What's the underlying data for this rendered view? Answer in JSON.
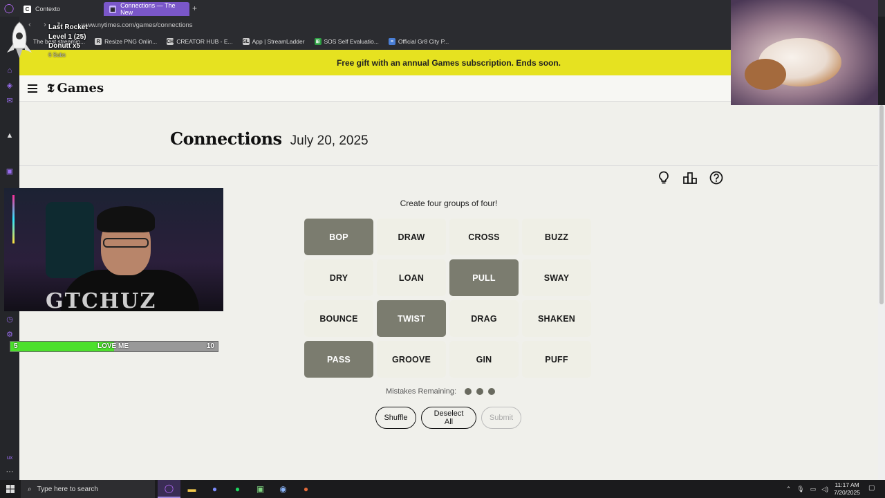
{
  "browser": {
    "tabs": [
      {
        "label": "Contexto",
        "icon": "C"
      },
      {
        "label": "Connections — The New",
        "icon": "▦"
      }
    ],
    "new_tab": "+",
    "url": "www.nytimes.com/games/connections",
    "bookmarks": [
      {
        "label": "The best streamin...",
        "icon": ""
      },
      {
        "label": "Resize PNG Onlin...",
        "icon": "R"
      },
      {
        "label": "CREATOR HUB - E...",
        "icon": "CH"
      },
      {
        "label": "App | StreamLadder",
        "icon": "SL"
      },
      {
        "label": "SOS Self Evaluatio...",
        "icon": "⊞"
      },
      {
        "label": "Official Gr8 City P...",
        "icon": "≡"
      }
    ]
  },
  "overlay": {
    "last_rocket": "Last Rocket",
    "level": "Level 1",
    "level_count": "(25)",
    "donut": "Donutt x5",
    "subs": "6 Subs",
    "hype_left": "5",
    "hype_label": "LOVE ME",
    "hype_right": "10",
    "hype_progress": 0.5,
    "cam_text": "GTCHUZ"
  },
  "promo": {
    "text": "Free gift with an annual Games subscription. Ends soon."
  },
  "header": {
    "logo_t": "𝕿",
    "logo_text": "Games"
  },
  "puzzle": {
    "title": "Connections",
    "date": "July 20, 2025",
    "instructions": "Create four groups of four!",
    "tiles": [
      {
        "word": "BOP",
        "selected": true
      },
      {
        "word": "DRAW",
        "selected": false
      },
      {
        "word": "CROSS",
        "selected": false
      },
      {
        "word": "BUZZ",
        "selected": false
      },
      {
        "word": "DRY",
        "selected": false
      },
      {
        "word": "LOAN",
        "selected": false
      },
      {
        "word": "PULL",
        "selected": true
      },
      {
        "word": "SWAY",
        "selected": false
      },
      {
        "word": "BOUNCE",
        "selected": false
      },
      {
        "word": "TWIST",
        "selected": true
      },
      {
        "word": "DRAG",
        "selected": false
      },
      {
        "word": "SHAKEN",
        "selected": false
      },
      {
        "word": "PASS",
        "selected": true
      },
      {
        "word": "GROOVE",
        "selected": false
      },
      {
        "word": "GIN",
        "selected": false
      },
      {
        "word": "PUFF",
        "selected": false
      }
    ],
    "mistakes_label": "Mistakes Remaining:",
    "mistakes_remaining": 3,
    "buttons": {
      "shuffle": "Shuffle",
      "deselect": "Deselect All",
      "submit": "Submit"
    }
  },
  "taskbar": {
    "search_placeholder": "Type here to search",
    "time": "11:17 AM",
    "date": "7/20/2025"
  },
  "colors": {
    "promo": "#e6e220",
    "tile": "#efefe6",
    "tile_selected": "#7b7c6f",
    "page_bg": "#f0f0eb"
  }
}
